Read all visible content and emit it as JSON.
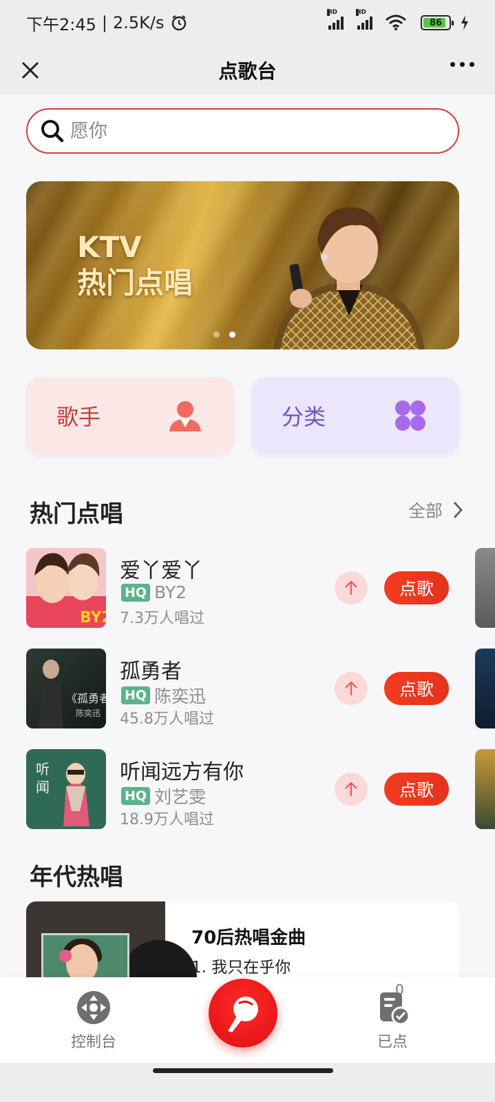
{
  "status_bar": {
    "time": "下午2:45",
    "speed": "2.5K/s",
    "battery": "86",
    "network_label": "HD"
  },
  "nav": {
    "title": "点歌台"
  },
  "search": {
    "placeholder": "愿你"
  },
  "banner": {
    "line1": "KTV",
    "line2": "热门点唱",
    "slide_count": 2,
    "active_slide": 2
  },
  "quick_links": {
    "singer_label": "歌手",
    "category_label": "分类"
  },
  "hot": {
    "title": "热门点唱",
    "more_label": "全部",
    "order_label": "点歌",
    "hq_label": "HQ",
    "songs": [
      {
        "name": "爱丫爱丫",
        "artist": "BY2",
        "count": "7.3万人唱过"
      },
      {
        "name": "孤勇者",
        "artist": "陈奕迅",
        "count": "45.8万人唱过"
      },
      {
        "name": "听闻远方有你",
        "artist": "刘艺雯",
        "count": "18.9万人唱过"
      }
    ]
  },
  "era": {
    "title": "年代热唱",
    "card_title": "70后热唱金曲",
    "first_item": "1. 我只在乎你"
  },
  "tabbar": {
    "console_label": "控制台",
    "ordered_label": "已点",
    "ordered_count": "0"
  },
  "colors": {
    "accent_red": "#e5331c",
    "search_border": "#d93b3b",
    "hq_green": "#5bb38a",
    "singer_card": "#fbe7e6",
    "category_card": "#ebe6fb"
  }
}
